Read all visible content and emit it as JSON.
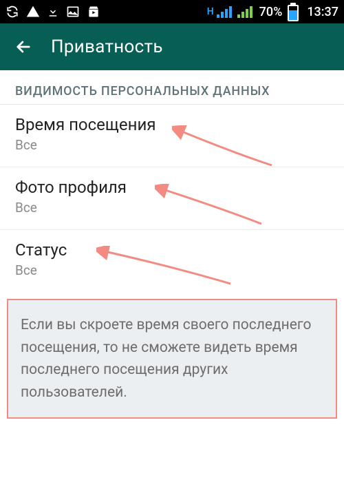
{
  "status_bar": {
    "battery_percent": "70%",
    "time": "13:37",
    "signal1_label": "H",
    "battery_fill_pct": 70
  },
  "app_bar": {
    "title": "Приватность"
  },
  "section_header": "ВИДИМОСТЬ ПЕРСОНАЛЬНЫХ ДАННЫХ",
  "settings": {
    "last_seen": {
      "title": "Время посещения",
      "value": "Все"
    },
    "profile_photo": {
      "title": "Фото профиля",
      "value": "Все"
    },
    "status": {
      "title": "Статус",
      "value": "Все"
    }
  },
  "info_text": "Если вы скроете время своего последнего посещения, то не сможете видеть время последнего посещения других пользователей."
}
